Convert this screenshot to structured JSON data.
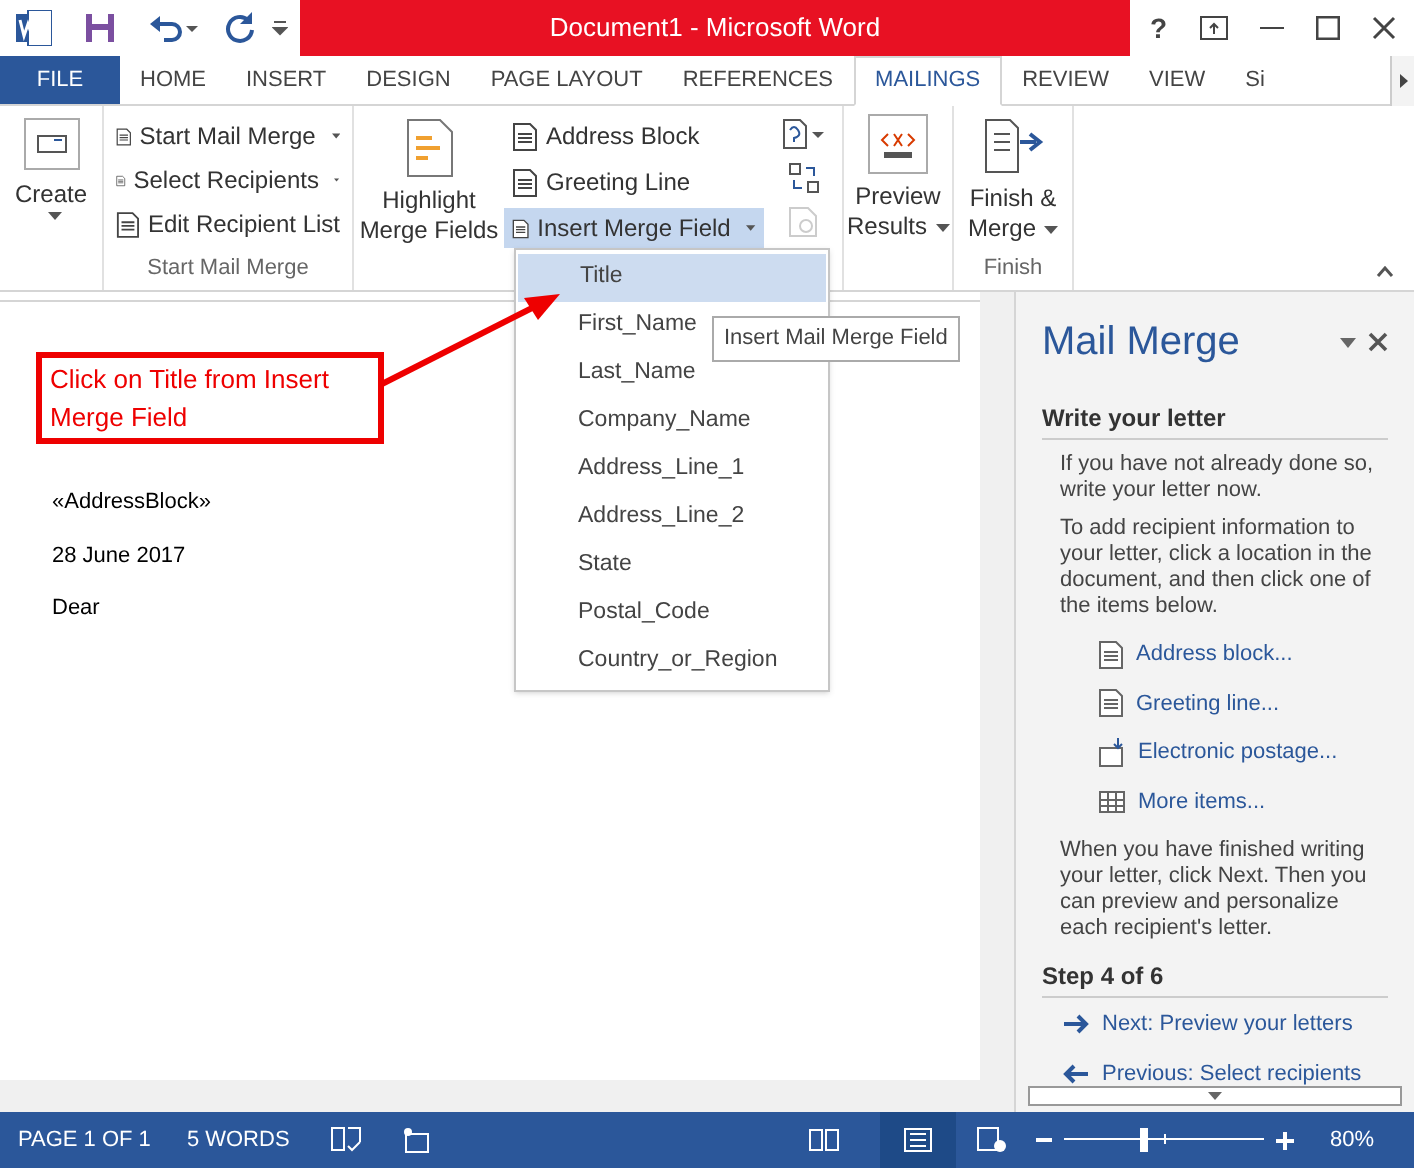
{
  "window": {
    "title": "Document1 -  Microsoft Word",
    "help": "?"
  },
  "tabs": [
    {
      "label": "FILE",
      "kind": "file",
      "selected": false
    },
    {
      "label": "HOME",
      "kind": "tab",
      "selected": false
    },
    {
      "label": "INSERT",
      "kind": "tab",
      "selected": false
    },
    {
      "label": "DESIGN",
      "kind": "tab",
      "selected": false
    },
    {
      "label": "PAGE LAYOUT",
      "kind": "tab",
      "selected": false
    },
    {
      "label": "REFERENCES",
      "kind": "tab",
      "selected": false
    },
    {
      "label": "MAILINGS",
      "kind": "tab",
      "selected": true
    },
    {
      "label": "REVIEW",
      "kind": "tab",
      "selected": false
    },
    {
      "label": "VIEW",
      "kind": "tab",
      "selected": false
    },
    {
      "label": "Si",
      "kind": "tab",
      "selected": false
    }
  ],
  "ribbon": {
    "create": "Create",
    "start_group": {
      "label": "Start Mail Merge",
      "items": [
        {
          "label": "Start Mail Merge",
          "dropdown": true
        },
        {
          "label": "Select Recipients",
          "dropdown": true
        },
        {
          "label": "Edit Recipient List",
          "dropdown": false
        }
      ]
    },
    "highlight": [
      "Highlight",
      "Merge Fields"
    ],
    "write_items": [
      {
        "label": "Address Block",
        "selected": false,
        "dropdown": false
      },
      {
        "label": "Greeting Line",
        "selected": false,
        "dropdown": false
      },
      {
        "label": "Insert Merge Field",
        "selected": true,
        "dropdown": true
      }
    ],
    "preview": [
      "Preview",
      "Results"
    ],
    "finish": [
      "Finish &",
      "Merge"
    ],
    "finish_group": "Finish"
  },
  "merge_fields": [
    {
      "label": "Title",
      "selected": true
    },
    {
      "label": "First_Name",
      "selected": false
    },
    {
      "label": "Last_Name",
      "selected": false
    },
    {
      "label": "Company_Name",
      "selected": false
    },
    {
      "label": "Address_Line_1",
      "selected": false
    },
    {
      "label": "Address_Line_2",
      "selected": false
    },
    {
      "label": "State",
      "selected": false
    },
    {
      "label": "Postal_Code",
      "selected": false
    },
    {
      "label": "Country_or_Region",
      "selected": false
    }
  ],
  "tooltip": "Insert Mail Merge Field",
  "annotation": "Click on Title from Insert Merge Field",
  "document": {
    "lines": [
      "«AddressBlock»",
      "28 June 2017",
      "Dear"
    ]
  },
  "task_pane": {
    "title": "Mail Merge",
    "heading": "Write your letter",
    "paragraphs": [
      "If you have not already done so, write your letter now.",
      "To add recipient information to your letter, click a location in the document, and then click one of the items below."
    ],
    "links": [
      {
        "label": "Address block...",
        "kind": "doc"
      },
      {
        "label": "Greeting line...",
        "kind": "doc"
      },
      {
        "label": "Electronic postage...",
        "kind": "postage"
      },
      {
        "label": "More items...",
        "kind": "table"
      }
    ],
    "closing": "When you have finished writing your letter, click Next. Then you can preview and personalize each recipient's letter.",
    "step": "Step 4 of 6",
    "nav": [
      {
        "label": "Next: Preview your letters",
        "kind": "next"
      },
      {
        "label": "Previous: Select recipients",
        "kind": "previous"
      }
    ]
  },
  "status_bar": {
    "page": "PAGE 1 OF 1",
    "words": "5 WORDS",
    "zoom": "80%",
    "zoom_slider": {
      "level": 0.4
    }
  }
}
